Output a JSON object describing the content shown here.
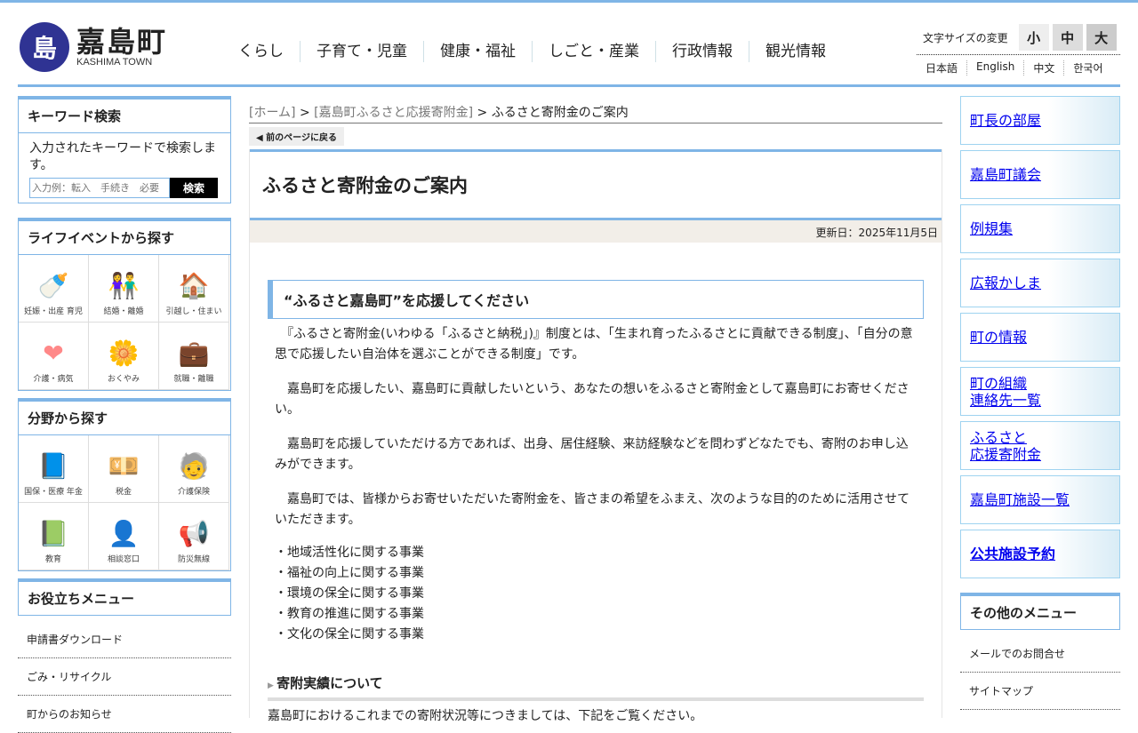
{
  "header": {
    "logo_mark": "島",
    "logo_title": "嘉島町",
    "logo_sub": "KASHIMA TOWN",
    "nav": [
      "くらし",
      "子育て・児童",
      "健康・福祉",
      "しごと・産業",
      "行政情報",
      "観光情報"
    ],
    "fontsize_label": "文字サイズの変更",
    "fontsize": [
      "小",
      "中",
      "大"
    ],
    "languages": [
      "日本語",
      "English",
      "中文",
      "한국어"
    ]
  },
  "sidebar": {
    "search": {
      "title": "キーワード検索",
      "desc": "入力されたキーワードで検索します。",
      "placeholder": "入力例：転入　手続き　必要",
      "button": "検索"
    },
    "life": {
      "title": "ライフイベントから探す",
      "items": [
        {
          "label": "妊娠・出産 育児",
          "icon": "🍼"
        },
        {
          "label": "結婚・離婚",
          "icon": "👫"
        },
        {
          "label": "引越し・住まい",
          "icon": "🏠"
        },
        {
          "label": "介護・病気",
          "icon": "❤"
        },
        {
          "label": "おくやみ",
          "icon": "🌼"
        },
        {
          "label": "就職・離職",
          "icon": "💼"
        }
      ]
    },
    "field": {
      "title": "分野から探す",
      "items": [
        {
          "label": "国保・医療 年金",
          "icon": "📘"
        },
        {
          "label": "税金",
          "icon": "💴"
        },
        {
          "label": "介護保険",
          "icon": "🧓"
        },
        {
          "label": "教育",
          "icon": "📗"
        },
        {
          "label": "相談窓口",
          "icon": "👤"
        },
        {
          "label": "防災無線",
          "icon": "📢"
        }
      ]
    },
    "useful": {
      "title": "お役立ちメニュー",
      "items": [
        "申請書ダウンロード",
        "ごみ・リサイクル",
        "町からのお知らせ"
      ]
    }
  },
  "breadcrumb": {
    "home": "[ホーム]",
    "parent": "[嘉島町ふるさと応援寄附金]",
    "sep": ">",
    "current": "ふるさと寄附金のご案内"
  },
  "back": "前のページに戻る",
  "main": {
    "title": "ふるさと寄附金のご案内",
    "updated": "更新日：2025年11月5日",
    "section": "“ふるさと嘉島町”を応援してください",
    "paragraphs": [
      "　『ふるさと寄附金(いわゆる「ふるさと納税」)』制度とは、「生まれ育ったふるさとに貢献できる制度」、「自分の意思で応援したい自治体を選ぶことができる制度」です。",
      "　嘉島町を応援したい、嘉島町に貢献したいという、あなたの想いをふるさと寄附金として嘉島町にお寄せください。",
      "　嘉島町を応援していただける方であれば、出身、居住経験、来訪経験などを問わずどなたでも、寄附のお申し込みができます。",
      "　嘉島町では、皆様からお寄せいただいた寄附金を、皆さまの希望をふまえ、次のような目的のために活用させていただきます。"
    ],
    "list": [
      "・地域活性化に関する事業",
      "・福祉の向上に関する事業",
      "・環境の保全に関する事業",
      "・教育の推進に関する事業",
      "・文化の保全に関する事業"
    ],
    "subsection": "寄附実績について",
    "last": "嘉島町におけるこれまでの寄附状況等につきましては、下記をご覧ください。"
  },
  "right": {
    "banners": [
      "町長の部屋",
      "嘉島町議会",
      "例規集",
      "広報かしま",
      "町の情報",
      "町の組織\n連絡先一覧",
      "ふるさと\n応援寄附金",
      "嘉島町施設一覧",
      "公共施設予約"
    ],
    "other_title": "その他のメニュー",
    "other": [
      "メールでのお問合せ",
      "サイトマップ"
    ]
  }
}
